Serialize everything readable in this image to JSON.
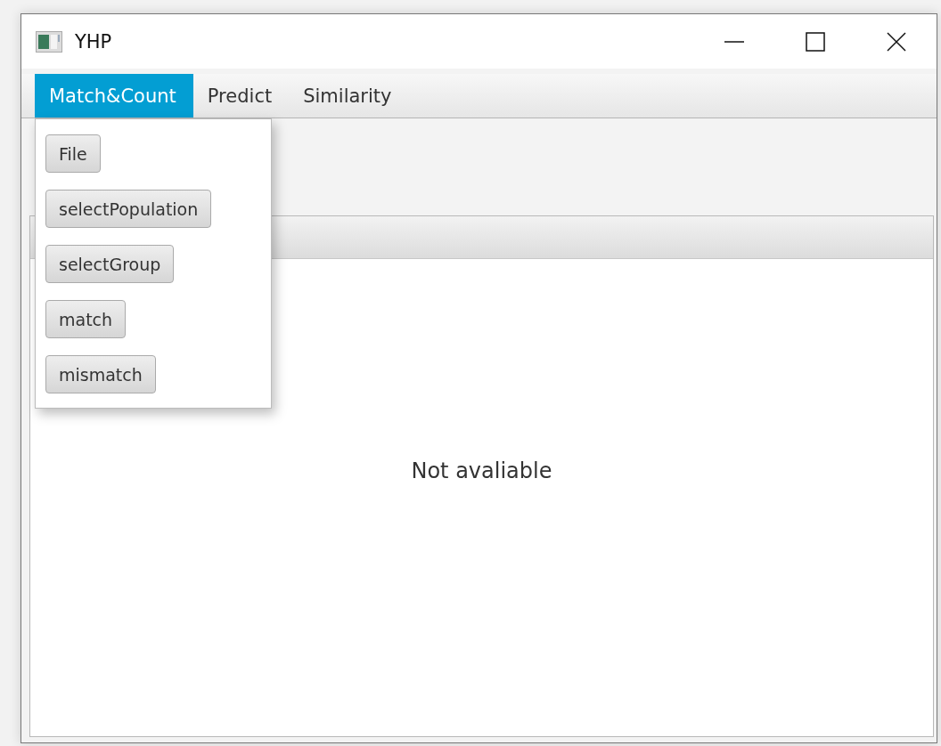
{
  "window": {
    "title": "YHP"
  },
  "menus": [
    {
      "label": "Match&Count",
      "selected": true
    },
    {
      "label": "Predict",
      "selected": false
    },
    {
      "label": "Similarity",
      "selected": false
    }
  ],
  "dropdown": {
    "items": [
      "File",
      "selectPopulation",
      "selectGroup",
      "match",
      "mismatch"
    ]
  },
  "table": {
    "placeholder": "Not avaliable"
  }
}
